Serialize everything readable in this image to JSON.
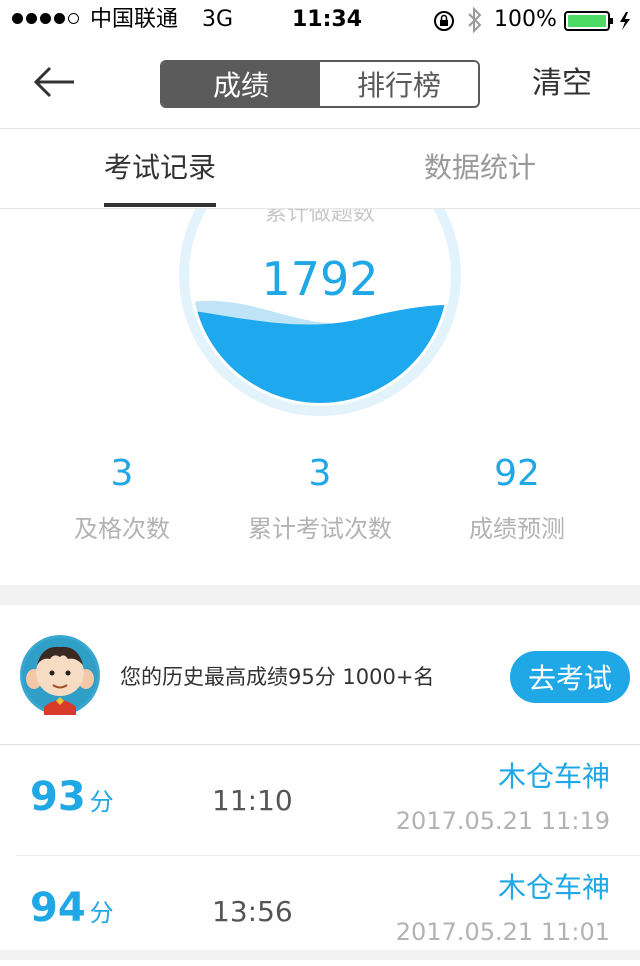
{
  "status_bar": {
    "carrier": "中国联通",
    "network": "3G",
    "time": "11:34",
    "battery": "100%",
    "signal_bars_filled": 4,
    "signal_bars_total": 5
  },
  "nav": {
    "back_icon": "arrow-left-icon",
    "segments": [
      "成绩",
      "排行榜"
    ],
    "active_segment": "成绩",
    "clear_label": "清空"
  },
  "tabs": {
    "items": [
      "考试记录",
      "数据统计"
    ],
    "active": "考试记录"
  },
  "gauge": {
    "label": "累计做题数",
    "value": "1792"
  },
  "stats": [
    {
      "value": "3",
      "label": "及格次数"
    },
    {
      "value": "3",
      "label": "累计考试次数"
    },
    {
      "value": "92",
      "label": "成绩预测"
    }
  ],
  "best": {
    "text": "您的历史最高成绩95分  1000+名",
    "button": "去考试"
  },
  "records": [
    {
      "score": "93",
      "unit": "分",
      "duration": "11:10",
      "name": "木仓车神",
      "date": "2017.05.21 11:19"
    },
    {
      "score": "94",
      "unit": "分",
      "duration": "13:56",
      "name": "木仓车神",
      "date": "2017.05.21 11:01"
    }
  ],
  "colors": {
    "accent": "#1fa7e6",
    "wave_light": "#bfe3f7",
    "ring": "#e3f3fc",
    "segment_active": "#5a5a5a",
    "muted_text": "#b3b3b3"
  }
}
